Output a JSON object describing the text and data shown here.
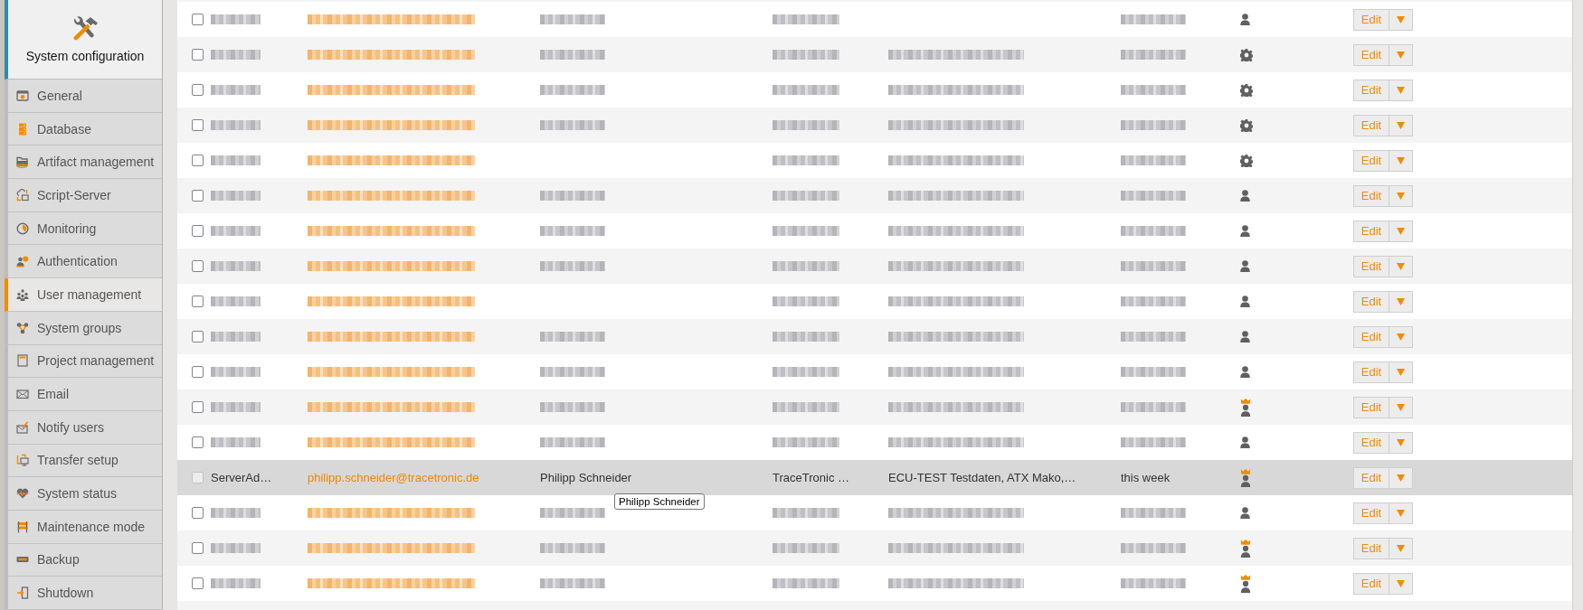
{
  "sidebar": {
    "title": "System configuration",
    "items": [
      {
        "label": "General",
        "selected": false
      },
      {
        "label": "Database",
        "selected": false
      },
      {
        "label": "Artifact management",
        "selected": false
      },
      {
        "label": "Script-Server",
        "selected": false
      },
      {
        "label": "Monitoring",
        "selected": false
      },
      {
        "label": "Authentication",
        "selected": false
      },
      {
        "label": "User management",
        "selected": true
      },
      {
        "label": "System groups",
        "selected": false
      },
      {
        "label": "Project management",
        "selected": false
      },
      {
        "label": "Email",
        "selected": false
      },
      {
        "label": "Notify users",
        "selected": false
      },
      {
        "label": "Transfer setup",
        "selected": false
      },
      {
        "label": "System status",
        "selected": false
      },
      {
        "label": "Maintenance mode",
        "selected": false
      },
      {
        "label": "Backup",
        "selected": false
      },
      {
        "label": "Shutdown",
        "selected": false
      }
    ]
  },
  "users_table": {
    "rows": [
      {
        "checked": false,
        "disabled": false,
        "highlighted": false,
        "username": {
          "blurred": true
        },
        "email": {
          "blurred": true
        },
        "full_name": {
          "blurred": true
        },
        "organization": {
          "blurred": true
        },
        "last_login": {
          "blurred": true
        },
        "role": {
          "kind": "user"
        },
        "edit": "Edit"
      },
      {
        "checked": false,
        "disabled": false,
        "highlighted": false,
        "username": {
          "blurred": true
        },
        "email": {
          "blurred": true
        },
        "full_name": {
          "blurred": true
        },
        "organization": {
          "blurred": true
        },
        "projects": {
          "blurred": true
        },
        "last_login": {
          "blurred": true
        },
        "role": {
          "kind": "system"
        },
        "edit": "Edit"
      },
      {
        "checked": false,
        "disabled": false,
        "highlighted": false,
        "username": {
          "blurred": true
        },
        "email": {
          "blurred": true
        },
        "full_name": {
          "blurred": true
        },
        "organization": {
          "blurred": true
        },
        "projects": {
          "blurred": true
        },
        "last_login": {
          "blurred": true
        },
        "role": {
          "kind": "system"
        },
        "edit": "Edit"
      },
      {
        "checked": false,
        "disabled": false,
        "highlighted": false,
        "username": {
          "blurred": true
        },
        "email": {
          "blurred": true
        },
        "full_name": {
          "blurred": true
        },
        "organization": {
          "blurred": true
        },
        "projects": {
          "blurred": true
        },
        "last_login": {
          "blurred": true
        },
        "role": {
          "kind": "system"
        },
        "edit": "Edit"
      },
      {
        "checked": false,
        "disabled": false,
        "highlighted": false,
        "username": {
          "blurred": true
        },
        "email": {
          "blurred": true
        },
        "organization": {
          "blurred": true
        },
        "projects": {
          "blurred": true
        },
        "last_login": {
          "blurred": true
        },
        "role": {
          "kind": "system"
        },
        "edit": "Edit"
      },
      {
        "checked": false,
        "disabled": false,
        "highlighted": false,
        "username": {
          "blurred": true
        },
        "email": {
          "blurred": true
        },
        "full_name": {
          "blurred": true
        },
        "organization": {
          "blurred": true
        },
        "projects": {
          "blurred": true
        },
        "last_login": {
          "blurred": true
        },
        "role": {
          "kind": "user"
        },
        "edit": "Edit"
      },
      {
        "checked": false,
        "disabled": false,
        "highlighted": false,
        "username": {
          "blurred": true
        },
        "email": {
          "blurred": true
        },
        "full_name": {
          "blurred": true
        },
        "organization": {
          "blurred": true
        },
        "projects": {
          "blurred": true
        },
        "last_login": {
          "blurred": true
        },
        "role": {
          "kind": "user"
        },
        "edit": "Edit"
      },
      {
        "checked": false,
        "disabled": false,
        "highlighted": false,
        "username": {
          "blurred": true
        },
        "email": {
          "blurred": true
        },
        "full_name": {
          "blurred": true
        },
        "organization": {
          "blurred": true
        },
        "projects": {
          "blurred": true
        },
        "last_login": {
          "blurred": true
        },
        "role": {
          "kind": "user"
        },
        "edit": "Edit"
      },
      {
        "checked": false,
        "disabled": false,
        "highlighted": false,
        "username": {
          "blurred": true
        },
        "email": {
          "blurred": true
        },
        "organization": {
          "blurred": true
        },
        "projects": {
          "blurred": true
        },
        "last_login": {
          "blurred": true
        },
        "role": {
          "kind": "user"
        },
        "edit": "Edit"
      },
      {
        "checked": false,
        "disabled": false,
        "highlighted": false,
        "username": {
          "blurred": true
        },
        "email": {
          "blurred": true
        },
        "full_name": {
          "blurred": true
        },
        "organization": {
          "blurred": true
        },
        "projects": {
          "blurred": true
        },
        "last_login": {
          "blurred": true
        },
        "role": {
          "kind": "user"
        },
        "edit": "Edit"
      },
      {
        "checked": false,
        "disabled": false,
        "highlighted": false,
        "username": {
          "blurred": true
        },
        "email": {
          "blurred": true
        },
        "full_name": {
          "blurred": true
        },
        "organization": {
          "blurred": true
        },
        "projects": {
          "blurred": true
        },
        "last_login": {
          "blurred": true
        },
        "role": {
          "kind": "user"
        },
        "edit": "Edit"
      },
      {
        "checked": false,
        "disabled": false,
        "highlighted": false,
        "username": {
          "blurred": true
        },
        "email": {
          "blurred": true
        },
        "full_name": {
          "blurred": true
        },
        "organization": {
          "blurred": true
        },
        "projects": {
          "blurred": true
        },
        "last_login": {
          "blurred": true
        },
        "role": {
          "kind": "admin"
        },
        "edit": "Edit"
      },
      {
        "checked": false,
        "disabled": false,
        "highlighted": false,
        "username": {
          "blurred": true
        },
        "email": {
          "blurred": true
        },
        "full_name": {
          "blurred": true
        },
        "organization": {
          "blurred": true
        },
        "projects": {
          "blurred": true
        },
        "last_login": {
          "blurred": true
        },
        "role": {
          "kind": "user"
        },
        "edit": "Edit"
      },
      {
        "checked": false,
        "disabled": true,
        "highlighted": true,
        "username": {
          "text": "ServerAd…"
        },
        "email": {
          "text": "philipp.schneider@tracetronic.de"
        },
        "full_name": {
          "text": "Philipp Schneider"
        },
        "organization": {
          "text": "TraceTronic …"
        },
        "projects": {
          "text": "ECU-TEST Testdaten, ATX Mako,…"
        },
        "last_login": {
          "text": "this week"
        },
        "role": {
          "kind": "admin"
        },
        "edit": "Edit",
        "tooltip": "Philipp Schneider"
      },
      {
        "checked": false,
        "disabled": false,
        "highlighted": false,
        "username": {
          "blurred": true
        },
        "email": {
          "blurred": true
        },
        "full_name": {
          "blurred": true
        },
        "organization": {
          "blurred": true
        },
        "projects": {
          "blurred": true
        },
        "last_login": {
          "blurred": true
        },
        "role": {
          "kind": "user"
        },
        "edit": "Edit"
      },
      {
        "checked": false,
        "disabled": false,
        "highlighted": false,
        "username": {
          "blurred": true
        },
        "email": {
          "blurred": true
        },
        "full_name": {
          "blurred": true
        },
        "organization": {
          "blurred": true
        },
        "projects": {
          "blurred": true
        },
        "last_login": {
          "blurred": true
        },
        "role": {
          "kind": "admin"
        },
        "edit": "Edit"
      },
      {
        "checked": false,
        "disabled": false,
        "highlighted": false,
        "username": {
          "blurred": true
        },
        "email": {
          "blurred": true
        },
        "full_name": {
          "blurred": true
        },
        "organization": {
          "blurred": true
        },
        "projects": {
          "blurred": true
        },
        "last_login": {
          "blurred": true
        },
        "role": {
          "kind": "admin"
        },
        "edit": "Edit"
      }
    ]
  }
}
